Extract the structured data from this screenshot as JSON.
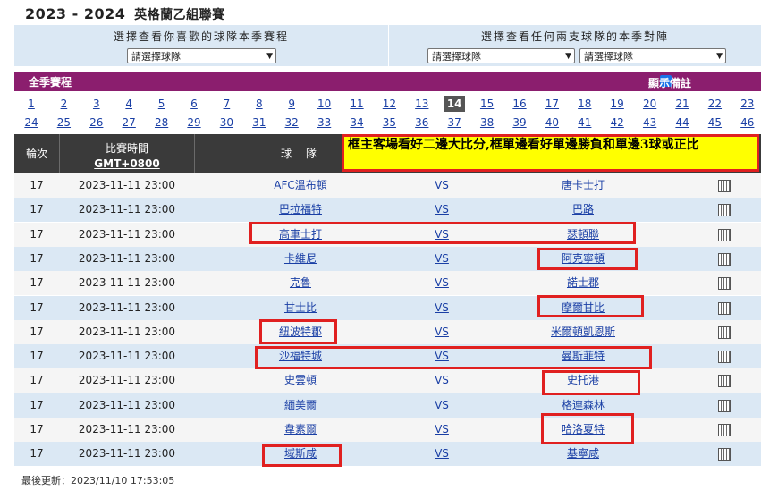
{
  "page_title": {
    "season": "2023 - 2024",
    "league": "英格蘭乙組聯賽"
  },
  "selectors": {
    "team_label": "選擇查看你喜歡的球隊本季賽程",
    "h2h_label": "選擇查看任何兩支球隊的本季對陣",
    "placeholder": "請選擇球隊"
  },
  "schedule": {
    "title": "全季賽程",
    "show_notes_label": "顯示備註",
    "show_notes_checked": true
  },
  "rounds": {
    "list": [
      "1",
      "2",
      "3",
      "4",
      "5",
      "6",
      "7",
      "8",
      "9",
      "10",
      "11",
      "12",
      "13",
      "14",
      "15",
      "16",
      "17",
      "18",
      "19",
      "20",
      "21",
      "22",
      "23",
      "24",
      "25",
      "26",
      "27",
      "28",
      "29",
      "30",
      "31",
      "32",
      "33",
      "34",
      "35",
      "36",
      "37",
      "38",
      "39",
      "40",
      "41",
      "42",
      "43",
      "44",
      "45",
      "46"
    ],
    "active": "14"
  },
  "table": {
    "headers": {
      "round": "輪次",
      "time": "比賽時間",
      "tz": "GMT+0800",
      "teams": "球 隊"
    },
    "rows": [
      {
        "round": "17",
        "time": "2023-11-11 23:00",
        "home": "AFC溫布頓",
        "vs": "VS",
        "away": "唐卡士打"
      },
      {
        "round": "17",
        "time": "2023-11-11 23:00",
        "home": "巴拉福特",
        "vs": "VS",
        "away": "巴路"
      },
      {
        "round": "17",
        "time": "2023-11-11 23:00",
        "home": "高車士打",
        "vs": "VS",
        "away": "瑟頓聯"
      },
      {
        "round": "17",
        "time": "2023-11-11 23:00",
        "home": "卡維尼",
        "vs": "VS",
        "away": "阿克寧頓"
      },
      {
        "round": "17",
        "time": "2023-11-11 23:00",
        "home": "克魯",
        "vs": "VS",
        "away": "諾士郡"
      },
      {
        "round": "17",
        "time": "2023-11-11 23:00",
        "home": "甘士比",
        "vs": "VS",
        "away": "摩爾甘比"
      },
      {
        "round": "17",
        "time": "2023-11-11 23:00",
        "home": "紐波特郡",
        "vs": "VS",
        "away": "米爾頓凱恩斯"
      },
      {
        "round": "17",
        "time": "2023-11-11 23:00",
        "home": "沙福特城",
        "vs": "VS",
        "away": "曼斯菲特"
      },
      {
        "round": "17",
        "time": "2023-11-11 23:00",
        "home": "史雲頓",
        "vs": "VS",
        "away": "史托港"
      },
      {
        "round": "17",
        "time": "2023-11-11 23:00",
        "home": "緬美爾",
        "vs": "VS",
        "away": "格連森林"
      },
      {
        "round": "17",
        "time": "2023-11-11 23:00",
        "home": "韋素爾",
        "vs": "VS",
        "away": "哈洛夏特"
      },
      {
        "round": "17",
        "time": "2023-11-11 23:00",
        "home": "域斯咸",
        "vs": "VS",
        "away": "基寧咸"
      }
    ]
  },
  "annotation": "框主客場看好二邊大比分,框單邊看好單邊勝負和單邊3球或正比",
  "last_updated": "最後更新：2023/11/10 17:53:05",
  "colors": {
    "purple_bar": "#8b1e6e",
    "header_dark": "#3a3a3a",
    "row_blue": "#dbe8f4",
    "link": "#1a3fa5",
    "highlight_red": "#e02020",
    "callout_yellow": "#ffff00"
  }
}
